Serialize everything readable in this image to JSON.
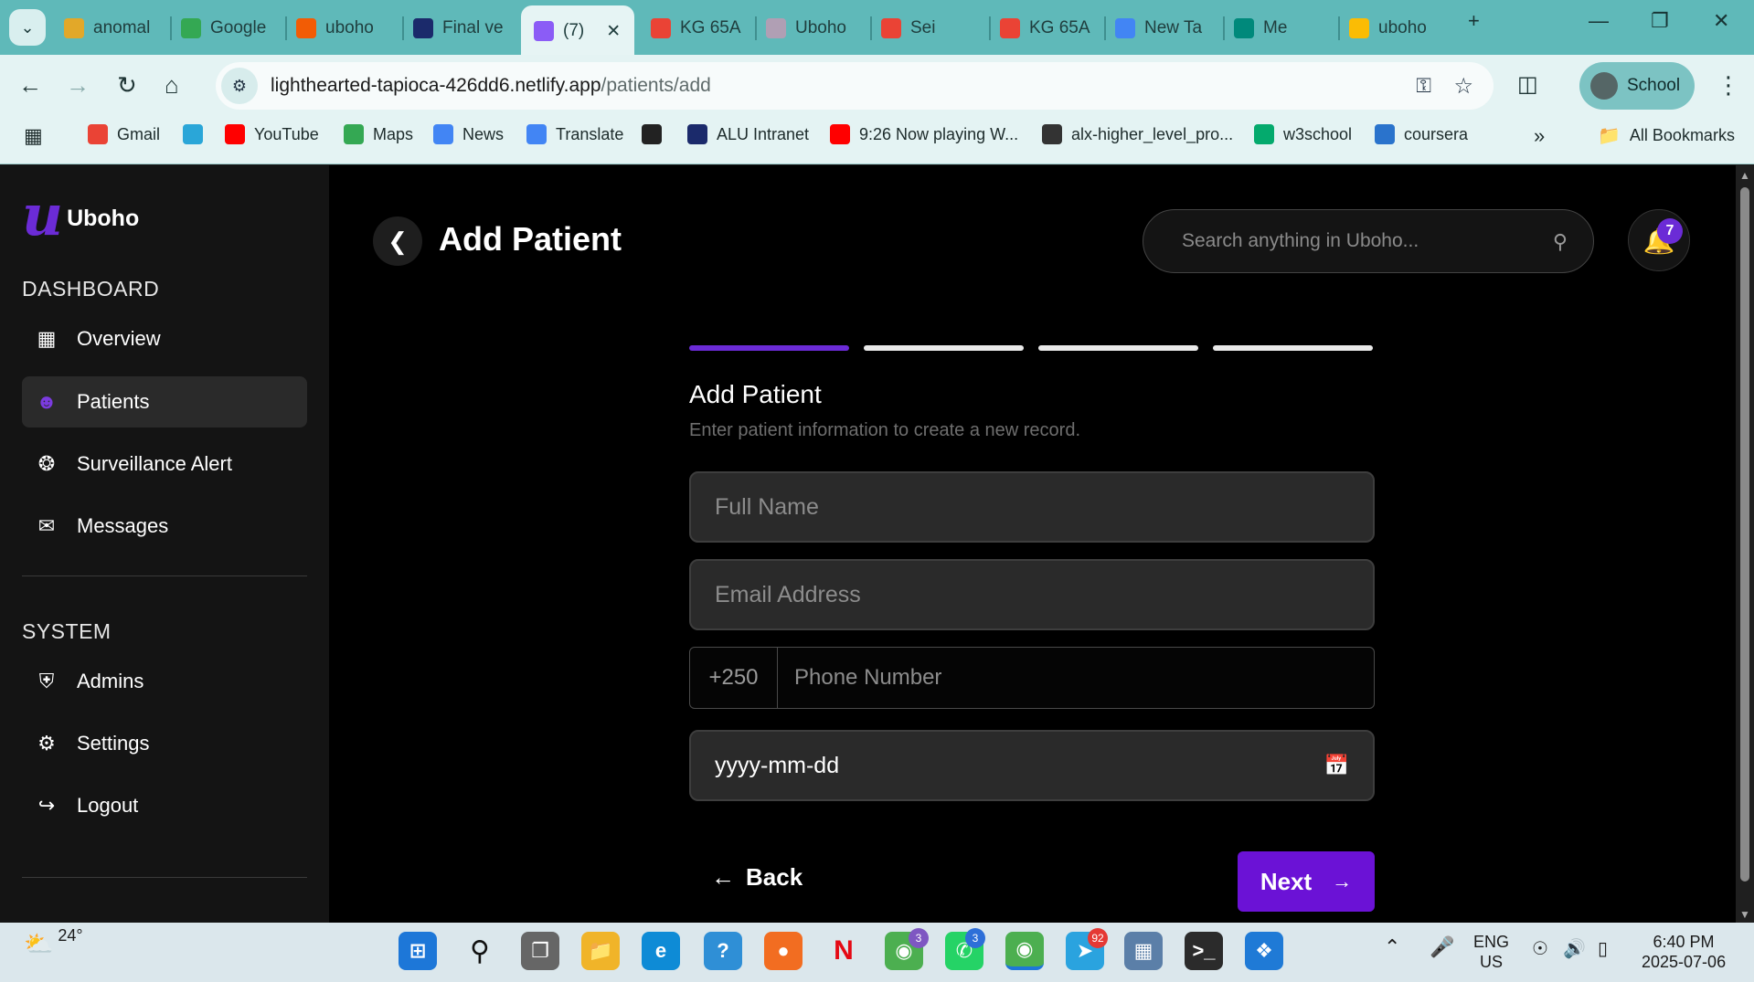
{
  "browser": {
    "tabs": [
      {
        "label": "anomal",
        "icon": "anomaly-icon",
        "color": "#e2a829"
      },
      {
        "label": "Google",
        "icon": "google-icon",
        "color": "#34a853"
      },
      {
        "label": "uboho",
        "icon": "fire-icon",
        "color": "#f25c05"
      },
      {
        "label": "Final ve",
        "icon": "alu-icon",
        "color": "#1b2a6b"
      },
      {
        "label": "(7)",
        "icon": "vite-icon",
        "color": "#8b5cf6",
        "active": true
      },
      {
        "label": "KG 65A",
        "icon": "maps-pin-icon",
        "color": "#ea4335"
      },
      {
        "label": "Uboho",
        "icon": "globe-icon",
        "color": "#b09fb4"
      },
      {
        "label": "Sei",
        "icon": "gmail-icon",
        "color": "#ea4335"
      },
      {
        "label": "KG 65A",
        "icon": "maps-pin-icon",
        "color": "#ea4335"
      },
      {
        "label": "New Ta",
        "icon": "chrome-icon",
        "color": "#4285f4"
      },
      {
        "label": "Me",
        "icon": "meet-icon",
        "color": "#00897b"
      },
      {
        "label": "uboho",
        "icon": "drive-icon",
        "color": "#fbbc04"
      }
    ],
    "url_host": "lighthearted-tapioca-426dd6.netlify.app",
    "url_path": "/patients/add",
    "profile": "School",
    "bookmarks": [
      {
        "label": "Gmail",
        "icon": "gmail-icon",
        "color": "#ea4335"
      },
      {
        "label": "",
        "icon": "cube-icon",
        "color": "#2aa6d8"
      },
      {
        "label": "YouTube",
        "icon": "youtube-icon",
        "color": "#ff0000"
      },
      {
        "label": "Maps",
        "icon": "maps-pin-icon",
        "color": "#34a853"
      },
      {
        "label": "News",
        "icon": "news-icon",
        "color": "#4285f4"
      },
      {
        "label": "Translate",
        "icon": "translate-icon",
        "color": "#4285f4"
      },
      {
        "label": "",
        "icon": "globe-icon",
        "color": "#222222"
      },
      {
        "label": "ALU Intranet",
        "icon": "alu-icon",
        "color": "#1b2a6b"
      },
      {
        "label": "9:26 Now playing W...",
        "icon": "youtube-icon",
        "color": "#ff0000"
      },
      {
        "label": "alx-higher_level_pro...",
        "icon": "github-icon",
        "color": "#333333"
      },
      {
        "label": "w3school",
        "icon": "w3-icon",
        "color": "#04aa6d"
      },
      {
        "label": "coursera",
        "icon": "coursera-icon",
        "color": "#2a73cc"
      }
    ],
    "all_bookmarks": "All Bookmarks",
    "more_bookmarks": "»"
  },
  "app": {
    "brand": {
      "mark": "u",
      "name": "Uboho",
      "accent": "#6b2bd6"
    },
    "sections": {
      "dashboard": "DASHBOARD",
      "system": "SYSTEM"
    },
    "nav_dashboard": [
      {
        "label": "Overview",
        "icon": "grid-icon"
      },
      {
        "label": "Patients",
        "icon": "users-icon",
        "active": true
      },
      {
        "label": "Surveillance Alert",
        "icon": "aperture-icon"
      },
      {
        "label": "Messages",
        "icon": "chat-icon"
      }
    ],
    "nav_system": [
      {
        "label": "Admins",
        "icon": "shield-user-icon"
      },
      {
        "label": "Settings",
        "icon": "gear-icon"
      },
      {
        "label": "Logout",
        "icon": "logout-icon"
      }
    ],
    "header": {
      "title": "Add Patient",
      "search_placeholder": "Search anything in Uboho...",
      "notifications": "7"
    },
    "form": {
      "steps_total": 4,
      "step_current": 1,
      "title": "Add Patient",
      "subtitle": "Enter patient information to create a new record.",
      "full_name_placeholder": "Full Name",
      "email_placeholder": "Email Address",
      "phone_code": "+250",
      "phone_placeholder": "Phone Number",
      "date_placeholder": "yyyy-mm-dd",
      "back_label": "Back",
      "next_label": "Next"
    }
  },
  "taskbar": {
    "weather": "24°",
    "lang_top": "ENG",
    "lang_bottom": "US",
    "time": "6:40 PM",
    "date": "2025-07-06",
    "badges": {
      "chrome": "3",
      "whatsapp": "3",
      "telegram": "92"
    }
  }
}
